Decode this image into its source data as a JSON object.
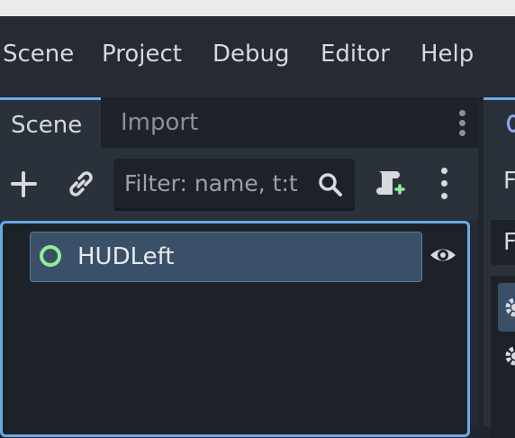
{
  "menubar": {
    "items": [
      "Scene",
      "Project",
      "Debug",
      "Editor",
      "Help"
    ]
  },
  "scene_dock": {
    "tabs": {
      "active": "Scene",
      "inactive": "Import"
    },
    "filter": {
      "placeholder": "Filter: name, t:t"
    },
    "tree": {
      "nodes": [
        {
          "label": "HUDLeft",
          "icon": "control-node-icon",
          "visible": true
        }
      ]
    }
  },
  "right_dock": {
    "text_1": "F",
    "text_2": "F"
  },
  "colors": {
    "accent": "#6ba9e6",
    "node_icon": "#8eef97",
    "selected_row": "#3a5068",
    "panel": "#252a33"
  }
}
